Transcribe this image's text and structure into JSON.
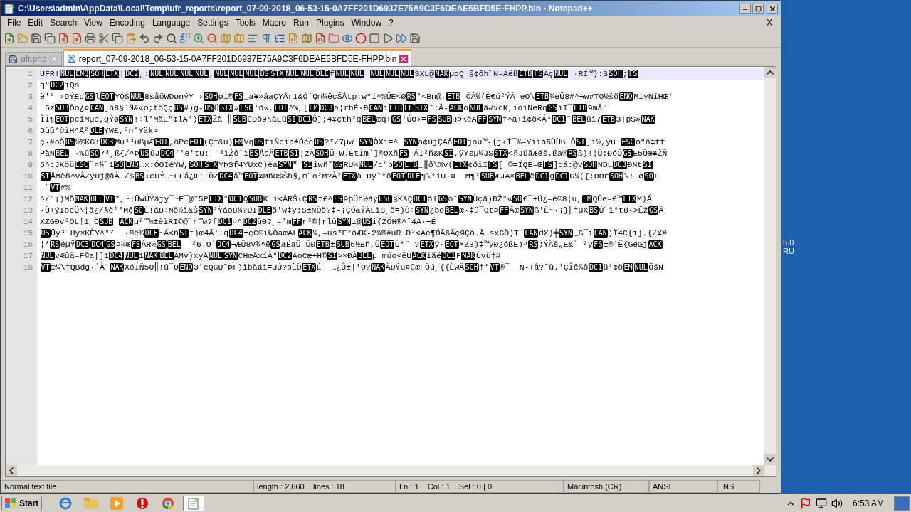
{
  "window": {
    "title": "C:\\Users\\admin\\AppData\\Local\\Temp\\ufr_reports\\report_07-09-2018_06-53-15-0A7FF201D6937E75A9C3F6DEAE5BFD5E-FHPP.bin - Notepad++"
  },
  "menu": [
    "File",
    "Edit",
    "Search",
    "View",
    "Encoding",
    "Language",
    "Settings",
    "Tools",
    "Macro",
    "Run",
    "Plugins",
    "Window",
    "?"
  ],
  "menu_close": "X",
  "tabs": [
    {
      "label": "ufr.php",
      "selected": false
    },
    {
      "label": "report_07-09-2018_06-53-15-0A7FF201D6937E75A9C3F6DEAE5BFD5E-FHPP.bin",
      "selected": true
    }
  ],
  "editor": {
    "lines": [
      {
        "number": "1",
        "current": true,
        "segments": [
          {
            "kind": "text",
            "text": "UFR!"
          },
          {
            "kind": "control",
            "text": "NUL"
          },
          {
            "kind": "control",
            "text": "ENQ"
          },
          {
            "kind": "control",
            "text": "SOH"
          },
          {
            "kind": "control",
            "text": "ETX"
          },
          {
            "kind": "text",
            "text": "|"
          },
          {
            "kind": "control",
            "text": "DC2"
          },
          {
            "kind": "text",
            "text": "¸:"
          },
          {
            "kind": "control",
            "text": "NUL"
          },
          {
            "kind": "control",
            "text": "NUL"
          },
          {
            "kind": "control",
            "text": "NUL"
          },
          {
            "kind": "control",
            "text": "NUL"
          },
          {
            "kind": "text",
            "text": ","
          },
          {
            "kind": "control",
            "text": "NUL"
          },
          {
            "kind": "control",
            "text": "NUL"
          },
          {
            "kind": "control",
            "text": "NUL"
          },
          {
            "kind": "control",
            "text": "BS"
          },
          {
            "kind": "control",
            "text": "STX"
          },
          {
            "kind": "control",
            "text": "NUL"
          },
          {
            "kind": "control",
            "text": "NUL"
          },
          {
            "kind": "control",
            "text": "DLE"
          },
          {
            "kind": "text",
            "text": "f"
          },
          {
            "kind": "control",
            "text": "NUL"
          },
          {
            "kind": "control",
            "text": "NUL"
          },
          {
            "kind": "gap"
          },
          {
            "kind": "control",
            "text": "NUL"
          },
          {
            "kind": "control",
            "text": "NUL"
          },
          {
            "kind": "control",
            "text": "NUL"
          },
          {
            "kind": "text",
            "text": "ŠXL@"
          },
          {
            "kind": "control",
            "text": "NAK"
          },
          {
            "kind": "text",
            "text": "µqÇ §¢ôh˝Ñ–Äëß"
          },
          {
            "kind": "control",
            "text": "ETB"
          },
          {
            "kind": "control",
            "text": "FS"
          },
          {
            "kind": "text",
            "text": "Äç"
          },
          {
            "kind": "control",
            "text": "NUL"
          },
          {
            "kind": "text",
            "text": " ·RÍ™):S"
          },
          {
            "kind": "control",
            "text": "SOH"
          },
          {
            "kind": "text",
            "text": ";"
          },
          {
            "kind": "control",
            "text": "FS"
          }
        ]
      },
      {
        "number": "2",
        "current": false,
        "segments": [
          {
            "kind": "text",
            "text": "q\""
          },
          {
            "kind": "control",
            "text": "DC2"
          },
          {
            "kind": "text",
            "text": "iQs"
          }
        ]
      },
      {
        "number": "3",
        "current": false,
        "segments": [
          {
            "kind": "text",
            "text": "ë'° ›9Ý£d"
          },
          {
            "kind": "control",
            "text": "GS"
          },
          {
            "kind": "text",
            "text": "l"
          },
          {
            "kind": "control",
            "text": "EOT"
          },
          {
            "kind": "text",
            "text": "YÓS"
          },
          {
            "kind": "control",
            "text": "NUL"
          },
          {
            "kind": "text",
            "text": "8såöWDønýY ›"
          },
          {
            "kind": "control",
            "text": "SOH"
          },
          {
            "kind": "text",
            "text": "øi®"
          },
          {
            "kind": "control",
            "text": "FS"
          },
          {
            "kind": "text",
            "text": "_a¥»áaÇYÅr1&Ó'Qm¼ëçŠÅtp:w*i^%ÜE<Ø"
          },
          {
            "kind": "control",
            "text": "RS"
          },
          {
            "kind": "text",
            "text": "'<Bn@,"
          },
          {
            "kind": "control",
            "text": "ETB"
          },
          {
            "kind": "text",
            "text": " ÔÁ½(É€ü²ŸÁ–eO\\"
          },
          {
            "kind": "control",
            "text": "ETB"
          },
          {
            "kind": "text",
            "text": "¼eÜ8#^¬w#TO½šõ"
          },
          {
            "kind": "control",
            "text": "ENQ"
          },
          {
            "kind": "text",
            "text": "MiyNíHŒ'"
          }
        ]
      },
      {
        "number": "4",
        "current": false,
        "segments": [
          {
            "kind": "text",
            "text": "¨5z"
          },
          {
            "kind": "control",
            "text": "SUB"
          },
          {
            "kind": "text",
            "text": "Õo¿¤"
          },
          {
            "kind": "control",
            "text": "CAN"
          },
          {
            "kind": "text",
            "text": "]ñ8§˜Ñ&«o;tôÇç"
          },
          {
            "kind": "control",
            "text": "BS"
          },
          {
            "kind": "text",
            "text": "#)g-"
          },
          {
            "kind": "control",
            "text": "US"
          },
          {
            "kind": "text",
            "text": "Ü"
          },
          {
            "kind": "control",
            "text": "STX"
          },
          {
            "kind": "text",
            "text": "»"
          },
          {
            "kind": "control",
            "text": "ESC"
          },
          {
            "kind": "text",
            "text": "'ñ«,"
          },
          {
            "kind": "control",
            "text": "EOT"
          },
          {
            "kind": "text",
            "text": "^%¸["
          },
          {
            "kind": "control",
            "text": "EM"
          },
          {
            "kind": "control",
            "text": "DC3"
          },
          {
            "kind": "text",
            "text": "ä¦rbÉ·Ð"
          },
          {
            "kind": "control",
            "text": "CAN"
          },
          {
            "kind": "text",
            "text": "i"
          },
          {
            "kind": "control",
            "text": "ETB"
          },
          {
            "kind": "control",
            "text": "FF"
          },
          {
            "kind": "control",
            "text": "STX"
          },
          {
            "kind": "text",
            "text": "˜:Â-"
          },
          {
            "kind": "control",
            "text": "ACK"
          },
          {
            "kind": "text",
            "text": "ö"
          },
          {
            "kind": "control",
            "text": "NUL"
          },
          {
            "kind": "text",
            "text": "ã#vöK,íóìNéRq"
          },
          {
            "kind": "control",
            "text": "GS"
          },
          {
            "kind": "text",
            "text": "îI¯"
          },
          {
            "kind": "control",
            "text": "ETB"
          },
          {
            "kind": "text",
            "text": "9må°"
          }
        ]
      },
      {
        "number": "5",
        "current": false,
        "segments": [
          {
            "kind": "text",
            "text": "ÎÍ¶"
          },
          {
            "kind": "control",
            "text": "EOT"
          },
          {
            "kind": "text",
            "text": "pciMµe,QÝø"
          },
          {
            "kind": "control",
            "text": "SYN"
          },
          {
            "kind": "text",
            "text": "!÷l'MäE\"¢lA')"
          },
          {
            "kind": "control",
            "text": "ETX"
          },
          {
            "kind": "text",
            "text": "Žà_‖"
          },
          {
            "kind": "control",
            "text": "SUB"
          },
          {
            "kind": "text",
            "text": "ûÐö9\\äEü"
          },
          {
            "kind": "control",
            "text": "SI"
          },
          {
            "kind": "control",
            "text": "DC1"
          },
          {
            "kind": "text",
            "text": "Ô];4¥çth²q"
          },
          {
            "kind": "control",
            "text": "BEL"
          },
          {
            "kind": "text",
            "text": "æq+"
          },
          {
            "kind": "control",
            "text": "GS"
          },
          {
            "kind": "text",
            "text": "'ÚO›="
          },
          {
            "kind": "control",
            "text": "FS"
          },
          {
            "kind": "control",
            "text": "SUB"
          },
          {
            "kind": "text",
            "text": "HÞKëA"
          },
          {
            "kind": "control",
            "text": "FF"
          },
          {
            "kind": "control",
            "text": "SYN"
          },
          {
            "kind": "text",
            "text": "†^a+î¢ö<Á*"
          },
          {
            "kind": "control",
            "text": "DC1"
          },
          {
            "kind": "text",
            "text": "˜"
          },
          {
            "kind": "control",
            "text": "BEL"
          },
          {
            "kind": "text",
            "text": "ûì7"
          },
          {
            "kind": "control",
            "text": "ETB"
          },
          {
            "kind": "text",
            "text": "3|p$»"
          },
          {
            "kind": "control",
            "text": "NAK"
          }
        ]
      },
      {
        "number": "6",
        "current": false,
        "segments": [
          {
            "kind": "text",
            "text": "Dùû*òìH^Å²"
          },
          {
            "kind": "control",
            "text": "DLE"
          },
          {
            "kind": "text",
            "text": "ÝW£,³n'Yäk>"
          }
        ]
      },
      {
        "number": "7",
        "current": false,
        "segments": [
          {
            "kind": "text",
            "text": "ç·#öÒ"
          },
          {
            "kind": "control",
            "text": "RS"
          },
          {
            "kind": "text",
            "text": "½%KG:"
          },
          {
            "kind": "control",
            "text": "DC3"
          },
          {
            "kind": "text",
            "text": "Mü³³úßµÆ"
          },
          {
            "kind": "control",
            "text": "EOT"
          },
          {
            "kind": "text",
            "text": ",ôPc"
          },
          {
            "kind": "control",
            "text": "EOT"
          },
          {
            "kind": "text",
            "text": "(Ç†&ú)"
          },
          {
            "kind": "control",
            "text": "EM"
          },
          {
            "kind": "text",
            "text": "Vq"
          },
          {
            "kind": "control",
            "text": "US"
          },
          {
            "kind": "text",
            "text": "fîÑëip±Óèc"
          },
          {
            "kind": "control",
            "text": "US"
          },
          {
            "kind": "text",
            "text": "?*/7µw "
          },
          {
            "kind": "control",
            "text": "SYN"
          },
          {
            "kind": "text",
            "text": "ÒXi=^ "
          },
          {
            "kind": "control",
            "text": "SYN"
          },
          {
            "kind": "text",
            "text": "ä¢ûjÇAå"
          },
          {
            "kind": "control",
            "text": "EOT"
          },
          {
            "kind": "text",
            "text": "jöú™-{j‹Í¯%–Yîíó5ÜÜß Ô"
          },
          {
            "kind": "control",
            "text": "SI"
          },
          {
            "kind": "text",
            "text": "]í½,ÿü'"
          },
          {
            "kind": "control",
            "text": "ESC"
          },
          {
            "kind": "text",
            "text": "o\"ô‡ff"
          }
        ]
      },
      {
        "number": "8",
        "current": false,
        "segments": [
          {
            "kind": "text",
            "text": "PàN"
          },
          {
            "kind": "control",
            "text": "BEL"
          },
          {
            "kind": "text",
            "text": " ·%û"
          },
          {
            "kind": "control",
            "text": "SO"
          },
          {
            "kind": "text",
            "text": "7³¸ß{/^Þ"
          },
          {
            "kind": "control",
            "text": "US"
          },
          {
            "kind": "text",
            "text": "ûJ"
          },
          {
            "kind": "control",
            "text": "DC4"
          },
          {
            "kind": "text",
            "text": "''e'tu:  ³ìŽô`ì"
          },
          {
            "kind": "control",
            "text": "BS"
          },
          {
            "kind": "text",
            "text": "ÅoÂ"
          },
          {
            "kind": "control",
            "text": "ETB"
          },
          {
            "kind": "control",
            "text": "SI"
          },
          {
            "kind": "text",
            "text": ";zÀ"
          },
          {
            "kind": "control",
            "text": "SOH"
          },
          {
            "kind": "text",
            "text": "Ü·W.ÉtÍm`]®OXñ"
          },
          {
            "kind": "control",
            "text": "FS"
          },
          {
            "kind": "text",
            "text": "-ÁÌ²ñ&K"
          },
          {
            "kind": "control",
            "text": "SI"
          },
          {
            "kind": "text",
            "text": ",ÿYsµ¼JS"
          },
          {
            "kind": "control",
            "text": "STX"
          },
          {
            "kind": "text",
            "text": "<§JúãÆëš.ßa®"
          },
          {
            "kind": "control",
            "text": "RS"
          },
          {
            "kind": "text",
            "text": "ß)!¦Ü;ÐóÓ"
          },
          {
            "kind": "control",
            "text": "GS"
          },
          {
            "kind": "text",
            "text": "E5Ôæ¥ŽÑ"
          }
        ]
      },
      {
        "number": "9",
        "current": false,
        "segments": [
          {
            "kind": "text",
            "text": "6^:JKöü"
          },
          {
            "kind": "control",
            "text": "ESC"
          },
          {
            "kind": "text",
            "text": "¨¤¾˝1"
          },
          {
            "kind": "control",
            "text": "SO"
          },
          {
            "kind": "control",
            "text": "ENQ"
          },
          {
            "kind": "text",
            "text": "…x:ÓÓÍéYW,"
          },
          {
            "kind": "control",
            "text": "SOH"
          },
          {
            "kind": "control",
            "text": "STX"
          },
          {
            "kind": "text",
            "text": "YÞSf4YUxC)èa"
          },
          {
            "kind": "control",
            "text": "SYN"
          },
          {
            "kind": "text",
            "text": "\"¡"
          },
          {
            "kind": "control",
            "text": "SI"
          },
          {
            "kind": "text",
            "text": "iwñ˜"
          },
          {
            "kind": "control",
            "text": "GS"
          },
          {
            "kind": "text",
            "text": "RÜ¼"
          },
          {
            "kind": "control",
            "text": "NUL"
          },
          {
            "kind": "text",
            "text": "/c°b"
          },
          {
            "kind": "control",
            "text": "SO"
          },
          {
            "kind": "control",
            "text": "ETB"
          },
          {
            "kind": "text",
            "text": "_‖ð\\%v("
          },
          {
            "kind": "control",
            "text": "ETX"
          },
          {
            "kind": "text",
            "text": "¢ðiI"
          },
          {
            "kind": "control",
            "text": "FS"
          },
          {
            "kind": "text",
            "text": "[¯©=ÍQÈ–Œ"
          },
          {
            "kind": "control",
            "text": "FS"
          },
          {
            "kind": "text",
            "text": "]qá:@v"
          },
          {
            "kind": "control",
            "text": "SOH"
          },
          {
            "kind": "text",
            "text": "NDL"
          },
          {
            "kind": "control",
            "text": "DC3"
          },
          {
            "kind": "text",
            "text": "ÐNt"
          },
          {
            "kind": "control",
            "text": "SI"
          }
        ]
      },
      {
        "number": "10",
        "current": false,
        "segments": [
          {
            "kind": "control",
            "text": "SI"
          },
          {
            "kind": "text",
            "text": "ÅMèñ^vÂZýÐj@âÀ…/$"
          },
          {
            "kind": "control",
            "text": "BS"
          },
          {
            "kind": "text",
            "text": "‹cUÝ…~EFå¿Œ:+ÕZ"
          },
          {
            "kind": "control",
            "text": "DC4"
          },
          {
            "kind": "text",
            "text": "å™"
          },
          {
            "kind": "control",
            "text": "EOT"
          },
          {
            "kind": "text",
            "text": "¥MñD$Šh§,m˝o²M?À²"
          },
          {
            "kind": "control",
            "text": "ETX"
          },
          {
            "kind": "text",
            "text": "à Dy˜°õ"
          },
          {
            "kind": "control",
            "text": "EOT"
          },
          {
            "kind": "control",
            "text": "DLE"
          },
          {
            "kind": "text",
            "text": "¶\\°iU·¤  M¶²"
          },
          {
            "kind": "control",
            "text": "SUB"
          },
          {
            "kind": "text",
            "text": "ÆJÀ×"
          },
          {
            "kind": "control",
            "text": "BEL"
          },
          {
            "kind": "text",
            "text": "ë"
          },
          {
            "kind": "control",
            "text": "DC1"
          },
          {
            "kind": "text",
            "text": "g"
          },
          {
            "kind": "control",
            "text": "DC1"
          },
          {
            "kind": "text",
            "text": "G¼({;DOr"
          },
          {
            "kind": "control",
            "text": "SOH"
          },
          {
            "kind": "text",
            "text": "\\:.ø"
          },
          {
            "kind": "control",
            "text": "SO"
          },
          {
            "kind": "text",
            "text": "£"
          }
        ]
      },
      {
        "number": "11",
        "current": false,
        "segments": [
          {
            "kind": "text",
            "text": "–¨"
          },
          {
            "kind": "control",
            "text": "VT"
          },
          {
            "kind": "text",
            "text": "#%"
          }
        ]
      },
      {
        "number": "12",
        "current": false,
        "segments": [
          {
            "kind": "text",
            "text": "^/\"¡)MÖ"
          },
          {
            "kind": "control",
            "text": "NAK"
          },
          {
            "kind": "control",
            "text": "BEL"
          },
          {
            "kind": "control",
            "text": "VT"
          },
          {
            "kind": "text",
            "text": "*¸~¡ÜwÚÝâjÿ¯~E¯@*5P"
          },
          {
            "kind": "control",
            "text": "ETX"
          },
          {
            "kind": "text",
            "text": "°"
          },
          {
            "kind": "control",
            "text": "DC1"
          },
          {
            "kind": "text",
            "text": "Q"
          },
          {
            "kind": "control",
            "text": "SUB"
          },
          {
            "kind": "text",
            "text": "K˝i<ÅRŠ‹Ç"
          },
          {
            "kind": "control",
            "text": "RS"
          },
          {
            "kind": "text",
            "text": "f£^"
          },
          {
            "kind": "control",
            "text": "FS"
          },
          {
            "kind": "text",
            "text": "9þÜh½ãý"
          },
          {
            "kind": "control",
            "text": "ESC"
          },
          {
            "kind": "text",
            "text": "§KšÇ"
          },
          {
            "kind": "control",
            "text": "DC1"
          },
          {
            "kind": "text",
            "text": "õl"
          },
          {
            "kind": "control",
            "text": "GS"
          },
          {
            "kind": "text",
            "text": "ò˜"
          },
          {
            "kind": "control",
            "text": "SYN"
          },
          {
            "kind": "text",
            "text": "Ùçã)ÐŽ°«"
          },
          {
            "kind": "control",
            "text": "SO"
          },
          {
            "kind": "text",
            "text": "€¯+Ü¿–é©8¦u,"
          },
          {
            "kind": "control",
            "text": "EM"
          },
          {
            "kind": "text",
            "text": "QÛe–€™"
          },
          {
            "kind": "control",
            "text": "ETX"
          },
          {
            "kind": "text",
            "text": "M)Á"
          }
        ]
      },
      {
        "number": "13",
        "current": false,
        "segments": [
          {
            "kind": "text",
            "text": "·Û+ýIoeÜ\\¦ã¿/§è¹'Mê"
          },
          {
            "kind": "control",
            "text": "SO"
          },
          {
            "kind": "text",
            "text": "É!á8÷Nö½ì&Š"
          },
          {
            "kind": "control",
            "text": "SYN"
          },
          {
            "kind": "text",
            "text": "²Ÿáo8¼?UI"
          },
          {
            "kind": "control",
            "text": "DLE"
          },
          {
            "kind": "text",
            "text": "õ'w‡y:S±NÒõ?‡–¡ÇÓ&ÝÀLìS¸õ=)Ò÷"
          },
          {
            "kind": "control",
            "text": "SYN"
          },
          {
            "kind": "text",
            "text": "¿bo"
          },
          {
            "kind": "control",
            "text": "BEL"
          },
          {
            "kind": "text",
            "text": "æ·‡ü¯OtÞ"
          },
          {
            "kind": "control",
            "text": "FF"
          },
          {
            "kind": "text",
            "text": "Âæ"
          },
          {
            "kind": "control",
            "text": "SYN"
          },
          {
            "kind": "text",
            "text": "ß'Ê~·¡}‖†µX"
          },
          {
            "kind": "control",
            "text": "BS"
          },
          {
            "kind": "text",
            "text": "Ú˝ì°t8‹>Ëž"
          },
          {
            "kind": "control",
            "text": "GS"
          },
          {
            "kind": "text",
            "text": "Ä"
          }
        ]
      },
      {
        "number": "14",
        "current": false,
        "segments": [
          {
            "kind": "text",
            "text": "XZGÐv³ÖL†1¸Ò"
          },
          {
            "kind": "control",
            "text": "SUB"
          },
          {
            "kind": "gap"
          },
          {
            "kind": "control",
            "text": "ACK"
          },
          {
            "kind": "text",
            "text": "µ²™½±èìRÏ©@˝r™ø?f"
          },
          {
            "kind": "control",
            "text": "DC1"
          },
          {
            "kind": "text",
            "text": "¤^"
          },
          {
            "kind": "control",
            "text": "DC2"
          },
          {
            "kind": "text",
            "text": "ùÐ?¸–'m"
          },
          {
            "kind": "control",
            "text": "FF"
          },
          {
            "kind": "text",
            "text": "r³®†rlû"
          },
          {
            "kind": "control",
            "text": "SYN"
          },
          {
            "kind": "text",
            "text": "i@"
          },
          {
            "kind": "control",
            "text": "US"
          },
          {
            "kind": "text",
            "text": "i{ŽÓH®^¨4À·÷É"
          }
        ]
      },
      {
        "number": "15",
        "current": false,
        "segments": [
          {
            "kind": "control",
            "text": "US"
          },
          {
            "kind": "text",
            "text": "Üÿ³˝Hý×KÈY^°²  ·®ê%"
          },
          {
            "kind": "control",
            "text": "DLE"
          },
          {
            "kind": "text",
            "text": "~Á<ñ"
          },
          {
            "kind": "control",
            "text": "SI"
          },
          {
            "kind": "text",
            "text": "t)œ4Ã'÷q"
          },
          {
            "kind": "control",
            "text": "DC4"
          },
          {
            "kind": "text",
            "text": "±çC©ì‰ÒáœAL"
          },
          {
            "kind": "control",
            "text": "ACK"
          },
          {
            "kind": "text",
            "text": "¼,–ús*E²ôÆK-2¾®#uR…Ð²<Aè¶ÓÃ6Ãç9Çõ.Ä…sxGÖ)T´"
          },
          {
            "kind": "control",
            "text": "CAN"
          },
          {
            "kind": "text",
            "text": "dX)╪"
          },
          {
            "kind": "control",
            "text": "SYN"
          },
          {
            "kind": "text",
            "text": "_G¯í"
          },
          {
            "kind": "control",
            "text": "CAN"
          },
          {
            "kind": "text",
            "text": ")Ï4C{ì].{/¥#"
          }
        ]
      },
      {
        "number": "16",
        "current": false,
        "segments": [
          {
            "kind": "text",
            "text": "¦*"
          },
          {
            "kind": "control",
            "text": "RS"
          },
          {
            "kind": "text",
            "text": "éµŸ"
          },
          {
            "kind": "control",
            "text": "DC3"
          },
          {
            "kind": "control",
            "text": "DC4"
          },
          {
            "kind": "control",
            "text": "GS"
          },
          {
            "kind": "text",
            "text": "¤¼œ"
          },
          {
            "kind": "control",
            "text": "FS"
          },
          {
            "kind": "text",
            "text": "ÀR½"
          },
          {
            "kind": "control",
            "text": "GS"
          },
          {
            "kind": "control",
            "text": "BEL"
          },
          {
            "kind": "text",
            "text": "  ²6.O´"
          },
          {
            "kind": "control",
            "text": "DC4"
          },
          {
            "kind": "text",
            "text": "¬ÆÜ8V¾^ë"
          },
          {
            "kind": "control",
            "text": "GS"
          },
          {
            "kind": "text",
            "text": "ÆËaÜ ÛÐ"
          },
          {
            "kind": "control",
            "text": "ETB"
          },
          {
            "kind": "text",
            "text": "±"
          },
          {
            "kind": "control",
            "text": "SUB"
          },
          {
            "kind": "text",
            "text": "6½£ñ,Ü"
          },
          {
            "kind": "control",
            "text": "EOT"
          },
          {
            "kind": "text",
            "text": "Ù*¨–?"
          },
          {
            "kind": "control",
            "text": "ETX"
          },
          {
            "kind": "text",
            "text": "ÿ·"
          },
          {
            "kind": "control",
            "text": "EOT"
          },
          {
            "kind": "text",
            "text": "×Z3)‡™yÐ¿óßE)^"
          },
          {
            "kind": "control",
            "text": "RS"
          },
          {
            "kind": "text",
            "text": ";ÝÄš„E&` ²y"
          },
          {
            "kind": "control",
            "text": "FS"
          },
          {
            "kind": "text",
            "text": "±®'Ë{GéŒj"
          },
          {
            "kind": "control",
            "text": "ACK"
          }
        ]
      },
      {
        "number": "17",
        "current": false,
        "segments": [
          {
            "kind": "control",
            "text": "NUL"
          },
          {
            "kind": "text",
            "text": "vÆûä–F©a|]1"
          },
          {
            "kind": "control",
            "text": "DC4"
          },
          {
            "kind": "control",
            "text": "NUL"
          },
          {
            "kind": "text",
            "text": "1"
          },
          {
            "kind": "control",
            "text": "NAK"
          },
          {
            "kind": "control",
            "text": "BEL"
          },
          {
            "kind": "text",
            "text": "ÂMv)xyÅ"
          },
          {
            "kind": "control",
            "text": "NUL"
          },
          {
            "kind": "control",
            "text": "SYN"
          },
          {
            "kind": "text",
            "text": "CHœÅxíÀ°"
          },
          {
            "kind": "control",
            "text": "DC2"
          },
          {
            "kind": "text",
            "text": "ÄoCæ+H®"
          },
          {
            "kind": "control",
            "text": "SI"
          },
          {
            "kind": "text",
            "text": ">×ÐÂ"
          },
          {
            "kind": "control",
            "text": "BEL"
          },
          {
            "kind": "text",
            "text": "µ múo<ëÛ"
          },
          {
            "kind": "control",
            "text": "ACK"
          },
          {
            "kind": "text",
            "text": "iãë"
          },
          {
            "kind": "control",
            "text": "DC1"
          },
          {
            "kind": "text",
            "text": "F"
          },
          {
            "kind": "control",
            "text": "NAK"
          },
          {
            "kind": "text",
            "text": "Ûvù†#"
          }
        ]
      },
      {
        "number": "18",
        "current": false,
        "segments": [
          {
            "kind": "control",
            "text": "VT"
          },
          {
            "kind": "text",
            "text": "æ¼\\†QBdg·`À'"
          },
          {
            "kind": "control",
            "text": "NAK"
          },
          {
            "kind": "text",
            "text": "XóÍÑ5O‖!û¯O"
          },
          {
            "kind": "control",
            "text": "ENQ"
          },
          {
            "kind": "text",
            "text": "3'eQGU˜ÞF)ìbäái=µÚ?pËÖ"
          },
          {
            "kind": "control",
            "text": "ETX"
          },
          {
            "kind": "text",
            "text": "É  …¿Û±|¹O?"
          },
          {
            "kind": "control",
            "text": "NAK"
          },
          {
            "kind": "text",
            "text": "ÀÐÝu¤ûæFÕú¸{{ÈwÃ"
          },
          {
            "kind": "control",
            "text": "SOH"
          },
          {
            "kind": "text",
            "text": "†'"
          },
          {
            "kind": "control",
            "text": "VT"
          },
          {
            "kind": "text",
            "text": "®¯__N-Tå?˜ù.¹ÇÎë¾ò"
          },
          {
            "kind": "control",
            "text": "DC1"
          },
          {
            "kind": "text",
            "text": "ü²¢ö"
          },
          {
            "kind": "control",
            "text": "EM"
          },
          {
            "kind": "control",
            "text": "NUL"
          },
          {
            "kind": "text",
            "text": "ÖšN"
          }
        ]
      }
    ]
  },
  "status_bar": [
    "Normal text file",
    "length : 2,660    lines : 18",
    "Ln : 1    Col : 1    Sel : 0 | 0",
    "Macintosh (CR)",
    "ANSI",
    "INS"
  ],
  "desktop_text": [
    "5.0",
    "RU"
  ],
  "taskbar": {
    "start": "Start",
    "clock": "6:53 AM",
    "apps": [
      {
        "kind": "ie",
        "selected": false
      },
      {
        "kind": "folder",
        "selected": false
      },
      {
        "kind": "player",
        "selected": false
      },
      {
        "kind": "opera",
        "selected": false
      },
      {
        "kind": "chrome",
        "selected": false
      },
      {
        "kind": "notepad",
        "selected": true
      }
    ]
  }
}
